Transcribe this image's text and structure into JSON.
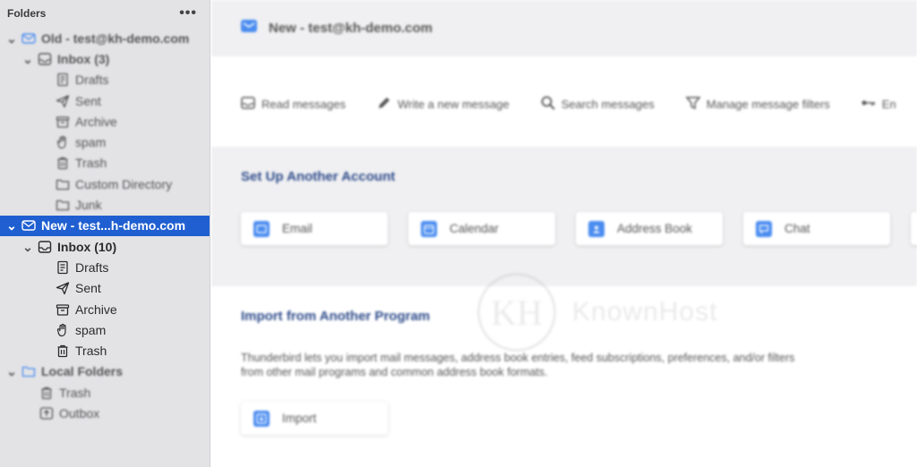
{
  "sidebar": {
    "header": "Folders",
    "more_icon": "more-dots-icon",
    "tree": [
      {
        "label": "Old - test@kh-demo.com",
        "icon": "account-icon",
        "level": 0,
        "twisty": "open",
        "bold": true,
        "blur": true
      },
      {
        "label": "Inbox (3)",
        "icon": "inbox-icon",
        "level": 1,
        "twisty": "open",
        "bold": true,
        "blur": true
      },
      {
        "label": "Drafts",
        "icon": "drafts-icon",
        "level": 2,
        "blur": true
      },
      {
        "label": "Sent",
        "icon": "sent-icon",
        "level": 2,
        "blur": true
      },
      {
        "label": "Archive",
        "icon": "archive-icon",
        "level": 2,
        "blur": true
      },
      {
        "label": "spam",
        "icon": "spam-icon",
        "level": 2,
        "blur": true
      },
      {
        "label": "Trash",
        "icon": "trash-icon",
        "level": 2,
        "blur": true
      },
      {
        "label": "Custom Directory",
        "icon": "folder-icon",
        "level": 2,
        "blur": true
      },
      {
        "label": "Junk",
        "icon": "folder-icon",
        "level": 2,
        "blur": true
      },
      {
        "label": "New - test...h-demo.com",
        "icon": "account-icon",
        "level": 0,
        "twisty": "open",
        "bold": true,
        "selected": true
      },
      {
        "label": "Inbox (10)",
        "icon": "inbox-icon",
        "level": 1,
        "twisty": "open",
        "bold": true
      },
      {
        "label": "Drafts",
        "icon": "drafts-icon",
        "level": 2
      },
      {
        "label": "Sent",
        "icon": "sent-icon",
        "level": 2
      },
      {
        "label": "Archive",
        "icon": "archive-icon",
        "level": 2
      },
      {
        "label": "spam",
        "icon": "spam-icon",
        "level": 2
      },
      {
        "label": "Trash",
        "icon": "trash-icon",
        "level": 2
      },
      {
        "label": "Local Folders",
        "icon": "folder-icon",
        "level": 0,
        "twisty": "open",
        "bold": true,
        "blur": true
      },
      {
        "label": "Trash",
        "icon": "trash-icon",
        "level": 3,
        "blur": true
      },
      {
        "label": "Outbox",
        "icon": "outbox-icon",
        "level": 3,
        "blur": true
      }
    ]
  },
  "main": {
    "account_title": "New - test@kh-demo.com",
    "actions": [
      {
        "label": "Read messages",
        "icon": "read-messages-icon"
      },
      {
        "label": "Write a new message",
        "icon": "pencil-icon"
      },
      {
        "label": "Search messages",
        "icon": "search-icon"
      },
      {
        "label": "Manage message filters",
        "icon": "filter-icon"
      },
      {
        "label": "En",
        "icon": "key-icon"
      }
    ],
    "setup_title": "Set Up Another Account",
    "setup_cards": [
      {
        "label": "Email",
        "icon": "email-icon"
      },
      {
        "label": "Calendar",
        "icon": "calendar-icon"
      },
      {
        "label": "Address Book",
        "icon": "address-book-icon"
      },
      {
        "label": "Chat",
        "icon": "chat-icon"
      }
    ],
    "import_title": "Import from Another Program",
    "import_description": "Thunderbird lets you import mail messages, address book entries, feed subscriptions, preferences, and/or filters from other mail programs and common address book formats.",
    "import_button": "Import"
  },
  "watermark": {
    "logo_text": "KH",
    "text": "KnownHost"
  },
  "colors": {
    "selection": "#1f5fd1",
    "accent_blue": "#4a8cf0",
    "section_title": "#2d4a8a",
    "sidebar_bg": "#e3e3e6"
  }
}
